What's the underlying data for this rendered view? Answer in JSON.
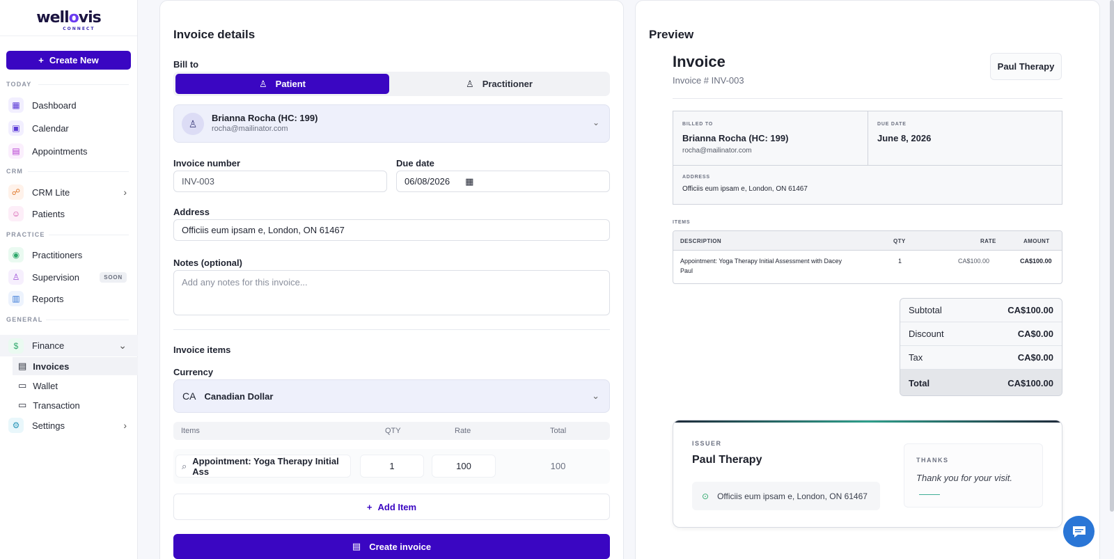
{
  "sidebar": {
    "logo": {
      "text_pre": "well",
      "text_o": "o",
      "text_post": "vis",
      "sub": "CONNECT"
    },
    "create_label": "Create New",
    "sections": {
      "today": "TODAY",
      "crm": "CRM",
      "practice": "PRACTICE",
      "general": "GENERAL"
    },
    "items": {
      "dashboard": "Dashboard",
      "calendar": "Calendar",
      "appointments": "Appointments",
      "crm_lite": "CRM Lite",
      "patients": "Patients",
      "practitioners": "Practitioners",
      "supervision": "Supervision",
      "supervision_badge": "SOON",
      "reports": "Reports",
      "finance": "Finance",
      "invoices": "Invoices",
      "wallet": "Wallet",
      "transaction": "Transaction",
      "settings": "Settings"
    }
  },
  "details": {
    "title": "Invoice details",
    "bill_to_label": "Bill to",
    "bill_to_options": {
      "patient": "Patient",
      "practitioner": "Practitioner"
    },
    "selected_patient": {
      "name": "Brianna Rocha (HC: 199)",
      "email": "rocha@mailinator.com"
    },
    "invoice_number_label": "Invoice number",
    "invoice_number_value": "INV-003",
    "due_date_label": "Due date",
    "due_date_value": "06/08/2026",
    "address_label": "Address",
    "address_value": "Officiis eum ipsam e, London, ON 61467",
    "notes_label": "Notes (optional)",
    "notes_placeholder": "Add any notes for this invoice...",
    "items_section_label": "Invoice items",
    "currency_label": "Currency",
    "currency_code": "CA",
    "currency_name": "Canadian Dollar",
    "items_headers": {
      "items": "Items",
      "qty": "QTY",
      "rate": "Rate",
      "total": "Total"
    },
    "item": {
      "name": "Appointment: Yoga Therapy Initial Ass",
      "qty": "1",
      "rate": "100",
      "total": "100"
    },
    "add_item_label": "Add Item",
    "create_invoice_label": "Create invoice"
  },
  "preview": {
    "title": "Preview",
    "invoice_heading": "Invoice",
    "invoice_number": "Invoice # INV-003",
    "issuer_chip": "Paul Therapy",
    "billed_to_label": "BILLED TO",
    "billed_to_name": "Brianna Rocha (HC: 199)",
    "billed_to_email": "rocha@mailinator.com",
    "due_date_label": "DUE DATE",
    "due_date_value": "June 8, 2026",
    "address_label": "ADDRESS",
    "address_value": "Officiis eum ipsam e, London, ON 61467",
    "items_label": "ITEMS",
    "table_headers": {
      "description": "DESCRIPTION",
      "qty": "QTY",
      "rate": "RATE",
      "amount": "AMOUNT"
    },
    "row": {
      "description_line1": "Appointment: Yoga Therapy Initial Assessment with Dacey",
      "description_line2": "Paul",
      "qty": "1",
      "rate": "CA$100.00",
      "amount": "CA$100.00"
    },
    "totals": {
      "subtotal_label": "Subtotal",
      "subtotal": "CA$100.00",
      "discount_label": "Discount",
      "discount": "CA$0.00",
      "tax_label": "Tax",
      "tax": "CA$0.00",
      "total_label": "Total",
      "total": "CA$100.00"
    },
    "footer": {
      "issuer_label": "ISSUER",
      "issuer_name": "Paul Therapy",
      "issuer_address": "Officiis eum ipsam e, London, ON 61467",
      "thanks_label": "THANKS",
      "thanks_text": "Thank you for your visit."
    }
  },
  "colors": {
    "primary": "#3a06c2",
    "tint": "#eef0fb",
    "chat": "#2a76d6"
  }
}
